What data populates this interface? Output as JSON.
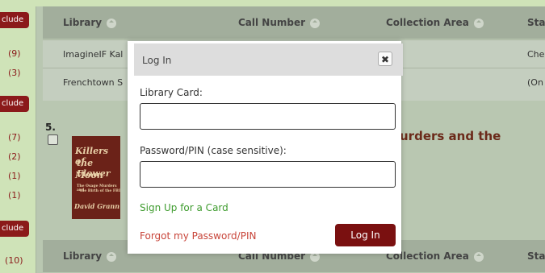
{
  "facets": {
    "include_label": "clude",
    "counts": [
      "(9)",
      "(3)",
      "(7)",
      "(2)",
      "(1)",
      "(1)",
      "(10)"
    ]
  },
  "table": {
    "headers": [
      "Library",
      "Call Number",
      "Collection Area",
      "Stat"
    ],
    "rows": [
      {
        "library": "ImagineIF Kal",
        "status": "Chec"
      },
      {
        "library": "Frenchtown S",
        "status": "(On"
      }
    ]
  },
  "result": {
    "number": "5.",
    "title_fragment": "urders and the",
    "cover": {
      "line1": "Killers of",
      "line2": "the Flower",
      "line3": "Moon",
      "subtitle1": "The Osage Murders and",
      "subtitle2": "the Birth of the FBI",
      "author": "David Grann"
    }
  },
  "modal": {
    "title": "Log In",
    "close_glyph": "✖",
    "card_label": "Library Card:",
    "card_value": "",
    "pin_label": "Password/PIN (case sensitive):",
    "pin_value": "",
    "signup_link": "Sign Up for a Card",
    "forgot_link": "Forgot my Password/PIN",
    "login_button": "Log In"
  },
  "colors": {
    "accent": "#7a1010",
    "signup": "#3f9c2f",
    "forgot": "#c8453a"
  }
}
